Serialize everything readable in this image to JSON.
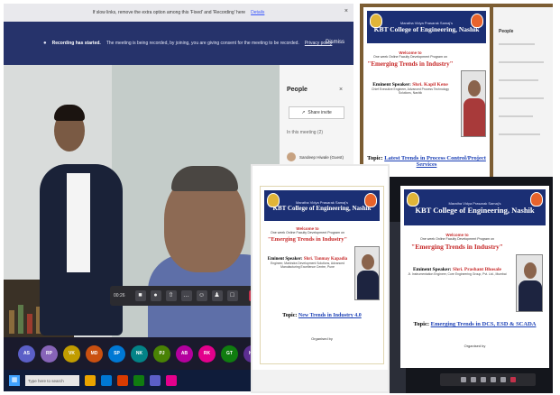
{
  "meeting": {
    "info_bar": {
      "text": "If slow links, remove the extra option among this 'Fixed' and 'Recording' here",
      "link": "Details",
      "close": "×"
    },
    "recording_bar": {
      "title": "Recording has started.",
      "text": "The meeting is being recorded, by joining, you are giving consent for the meeting to be recorded.",
      "link": "Privacy policy",
      "dismiss": "Dismiss"
    },
    "call_controls": {
      "timer": "00:26",
      "icons": [
        "video-icon",
        "mic-icon",
        "share-icon",
        "more-icon",
        "reactions-icon",
        "participants-icon",
        "chat-icon"
      ],
      "leave_icon": "phone-hangup-icon"
    },
    "people_panel": {
      "title": "People",
      "close": "×",
      "invite_label": "Share invite",
      "section": "In this meeting (2)",
      "participant": "Sandeep Hiwale (Guest)"
    },
    "participant_tiles": [
      {
        "initials": "AS",
        "color": "#5b5fc7"
      },
      {
        "initials": "RP",
        "color": "#8764b8"
      },
      {
        "initials": "VK",
        "color": "#c19c00"
      },
      {
        "initials": "MD",
        "color": "#ca5010"
      },
      {
        "initials": "SP",
        "color": "#0078d4"
      },
      {
        "initials": "NK",
        "color": "#038387"
      },
      {
        "initials": "PJ",
        "color": "#498205"
      },
      {
        "initials": "AB",
        "color": "#b4009e"
      },
      {
        "initials": "RK",
        "color": "#e3008c"
      },
      {
        "initials": "GT",
        "color": "#107c10"
      },
      {
        "initials": "HS",
        "color": "#5c2e91"
      }
    ],
    "taskbar": {
      "start_icon": "windows-icon",
      "search_placeholder": "Type here to search",
      "apps": [
        "#e8a400",
        "#0078d4",
        "#d83b01",
        "#107c10",
        "#5b5fc7",
        "#e3008c"
      ]
    }
  },
  "poster": {
    "trust": "Maratha Vidya Prasarak Samaj's",
    "college": "KBT College of Engineering, Nashik",
    "welcome": "Welcome to",
    "organised": "One week Online Faculty Development Program on",
    "theme": "\"Emerging Trends in Industry\"",
    "speaker_label": "Eminent Speaker:",
    "topic_label": "Topic:",
    "organised_by": "Organised by"
  },
  "sessions": [
    {
      "speaker": "Shri. Kapil Kene",
      "affiliation": "Chief Executive Engineer, Advanced Process Technology Solutions, Nashik",
      "topic": "Latest Trends in Process Control/Project Services"
    },
    {
      "speaker": "Shri. Tanmay Kapadia",
      "affiliation": "Engineer, Mahindra Development Solutions, Advanced Manufacturing Excellence Centre, Pune",
      "topic": "New Trends in Industry 4.0"
    },
    {
      "speaker": "Shri. Prashant Bhosale",
      "affiliation": "Jt. Instrumentation Engineer, Core Engineering Group, Pvt. Ltd., Mumbai",
      "topic": "Emerging Trends in DCS, ESD & SCADA"
    }
  ],
  "right_panel": {
    "title": "People"
  },
  "colors": {
    "banner": "#1b2f74",
    "accent_red": "#c62828",
    "teams_bar": "#26336b"
  }
}
